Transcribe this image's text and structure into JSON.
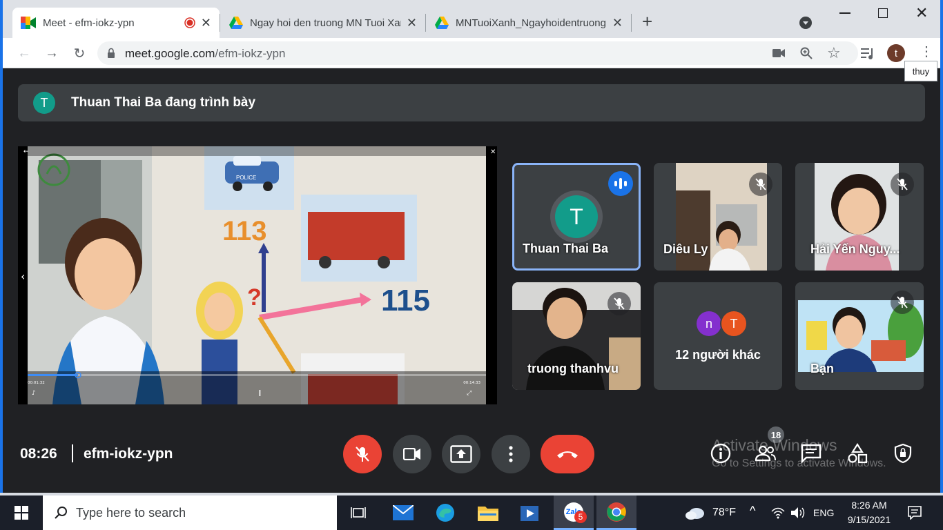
{
  "browser": {
    "tabs": [
      {
        "title": "Meet - efm-iokz-ypn",
        "recording": true
      },
      {
        "title": "Ngay hoi den truong MN Tuoi Xanh"
      },
      {
        "title": "MNTuoiXanh_Ngayhoidentruong"
      }
    ],
    "url_host": "meet.google.com",
    "url_path": "/efm-iokz-ypn",
    "profile_initial": "t",
    "profile_tooltip": "thuy"
  },
  "meet": {
    "presenter_initial": "T",
    "presenting_text": "Thuan Thai Ba đang trình bày",
    "video_overlay": {
      "time_current": "00:01:32",
      "time_total": "00:14:33",
      "progress_fraction": 0.11,
      "labels": [
        "113",
        "115",
        "POLICE"
      ]
    },
    "participants": [
      {
        "name": "Thuan Thai Ba",
        "initial": "T",
        "speaking": true
      },
      {
        "name": "Diêu Ly",
        "muted": true
      },
      {
        "name": "Hải Yến Nguy...",
        "muted": true
      },
      {
        "name": "truong thanhvu",
        "muted": true
      },
      {
        "name": "12 người khác",
        "initials": [
          "n",
          "T"
        ]
      },
      {
        "name": "Bạn",
        "muted": true
      }
    ],
    "time": "08:26",
    "meeting_code": "efm-iokz-ypn",
    "people_count": "18",
    "activate_line1": "Activate Windows",
    "activate_line2": "Go to Settings to activate Windows."
  },
  "taskbar": {
    "search_placeholder": "Type here to search",
    "zalo_badge": "5",
    "weather": "78°F",
    "language": "ENG",
    "clock_time": "8:26 AM",
    "clock_date": "9/15/2021"
  },
  "colors": {
    "meet_bg": "#202124",
    "tile_bg": "#3c4043",
    "accent": "#1a73e8",
    "danger": "#ea4335",
    "avatar_teal": "#129c8a"
  }
}
